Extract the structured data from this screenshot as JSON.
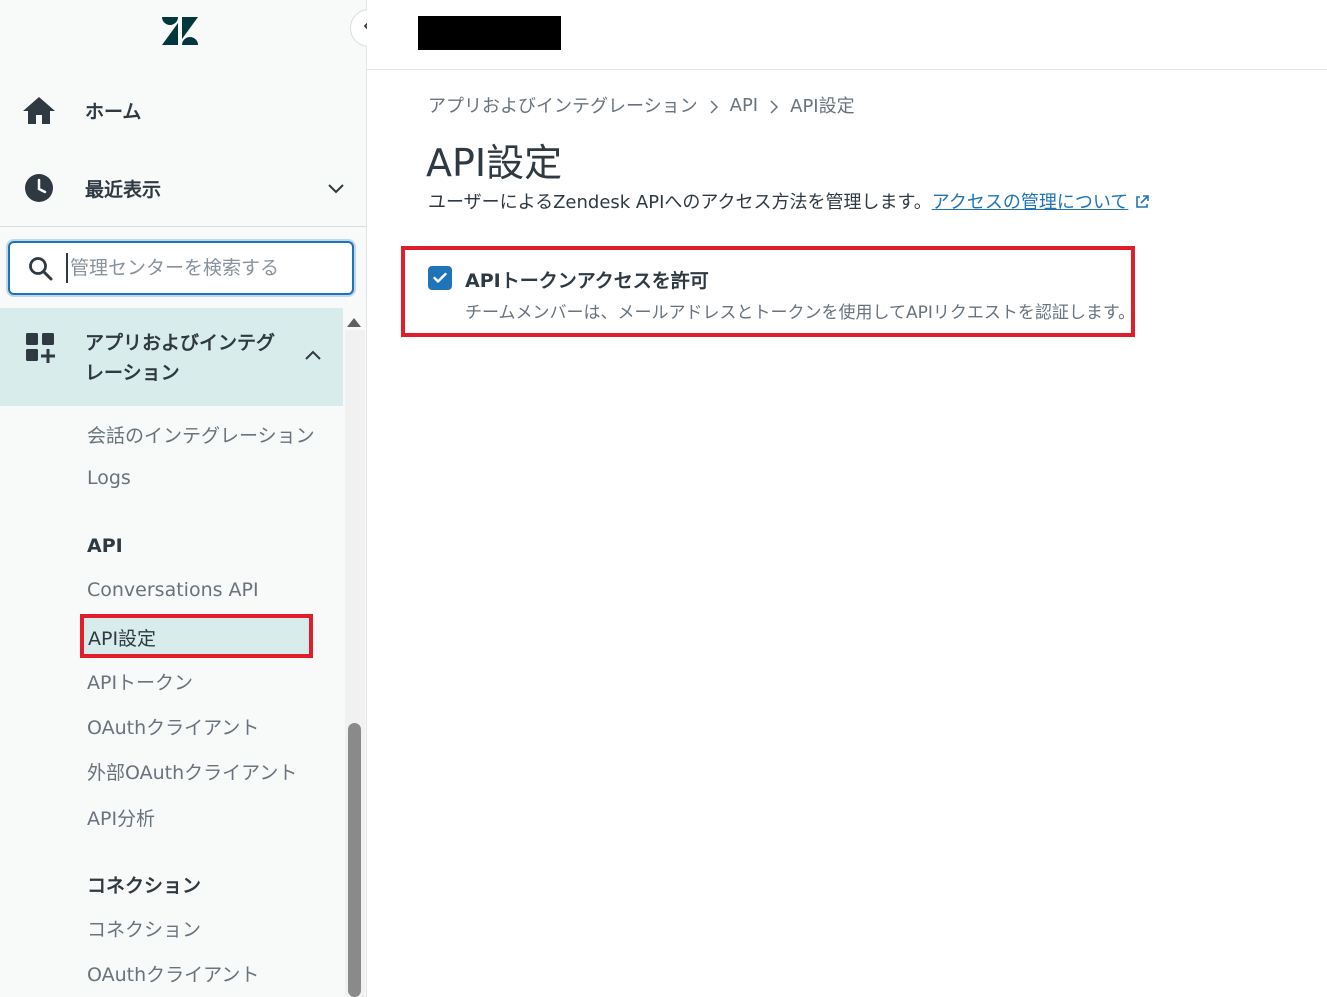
{
  "sidebar": {
    "home_label": "ホーム",
    "recent_label": "最近表示",
    "search_placeholder": "管理センターを検索する",
    "apps_label": "アプリおよびインテグレーション",
    "sub_items": {
      "conversation_integrations": "会話のインテグレーション",
      "logs": "Logs",
      "api_heading": "API",
      "conversations_api": "Conversations API",
      "api_settings": "API設定",
      "api_tokens": "APIトークン",
      "oauth_clients": "OAuthクライアント",
      "external_oauth_clients": "外部OAuthクライアント",
      "api_analytics": "API分析",
      "connections_heading": "コネクション",
      "connections": "コネクション",
      "oauth_clients_2": "OAuthクライアント"
    }
  },
  "breadcrumb": {
    "items": [
      "アプリおよびインテグレーション",
      "API",
      "API設定"
    ]
  },
  "page": {
    "title": "API設定",
    "description": "ユーザーによるZendesk APIへのアクセス方法を管理します。",
    "link_text": "アクセスの管理について"
  },
  "setting": {
    "label": "APIトークンアクセスを許可",
    "hint": "チームメンバーは、メールアドレスとトークンを使用してAPIリクエストを認証します。",
    "checked": true
  },
  "colors": {
    "accent": "#1f73b7",
    "highlight_border": "#e01e2b",
    "active_bg": "#d9ecec"
  }
}
